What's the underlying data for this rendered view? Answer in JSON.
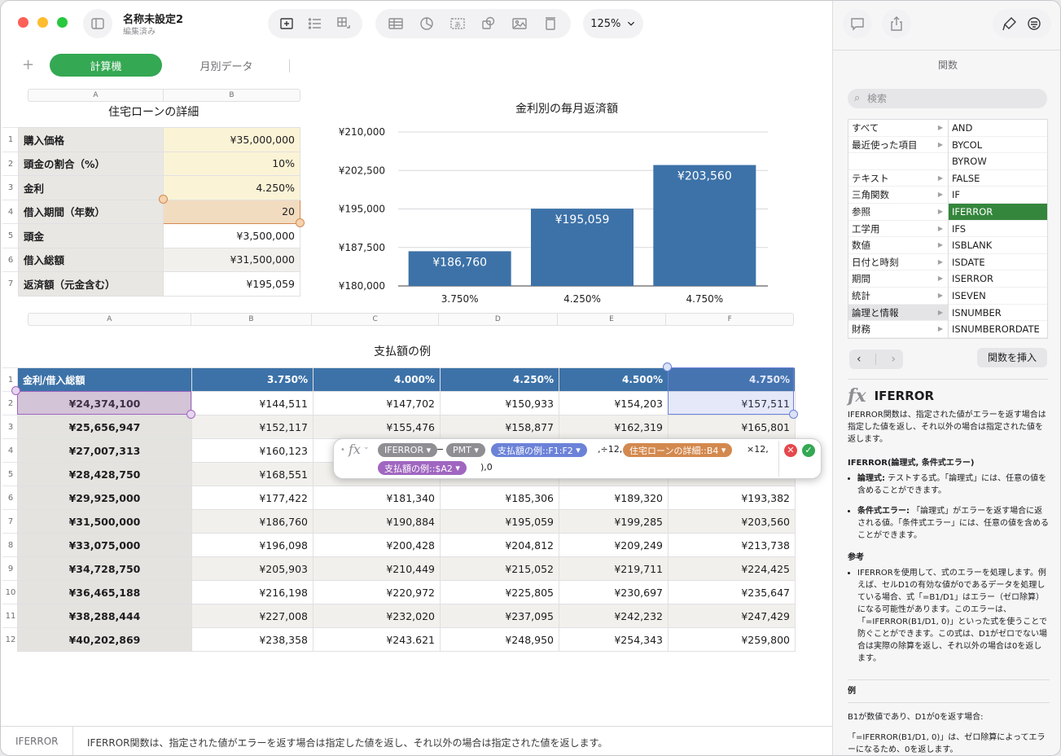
{
  "document": {
    "title": "名称未設定2",
    "subtitle": "編集済み",
    "zoom": "125%"
  },
  "tabs": [
    {
      "label": "計算機"
    },
    {
      "label": "月別データ"
    }
  ],
  "table1": {
    "title": "住宅ローンの詳細",
    "columns": [
      "A",
      "B"
    ],
    "rows": [
      {
        "num": "1",
        "label": "購入価格",
        "value": "¥35,000,000"
      },
      {
        "num": "2",
        "label": "頭金の割合（%）",
        "value": "10%"
      },
      {
        "num": "3",
        "label": "金利",
        "value": "4.250%"
      },
      {
        "num": "4",
        "label": "借入期間（年数）",
        "value": "20"
      },
      {
        "num": "5",
        "label": "頭金",
        "value": "¥3,500,000"
      },
      {
        "num": "6",
        "label": "借入総額",
        "value": "¥31,500,000"
      },
      {
        "num": "7",
        "label": "返済額（元金含む）",
        "value": "¥195,059"
      }
    ]
  },
  "chart_data": {
    "type": "bar",
    "title": "金利別の毎月返済額",
    "categories": [
      "3.750%",
      "4.250%",
      "4.750%"
    ],
    "values": [
      186760,
      195059,
      203560
    ],
    "value_labels": [
      "¥186,760",
      "¥195,059",
      "¥203,560"
    ],
    "ylim": [
      180000,
      210000
    ],
    "yticks": [
      "¥210,000",
      "¥202,500",
      "¥195,000",
      "¥187,500",
      "¥180,000"
    ],
    "color": "#3d72a8"
  },
  "table2": {
    "title": "支払額の例",
    "columns": [
      "A",
      "B",
      "C",
      "D",
      "E",
      "F"
    ],
    "header": [
      "金利/借入総額",
      "3.750%",
      "4.000%",
      "4.250%",
      "4.500%",
      "4.750%"
    ],
    "rows": [
      [
        "¥24,374,100",
        "¥144,511",
        "¥147,702",
        "¥150,933",
        "¥154,203",
        "¥157,511"
      ],
      [
        "¥25,656,947",
        "¥152,117",
        "¥155,476",
        "¥158,877",
        "¥162,319",
        "¥165,801"
      ],
      [
        "¥27,007,313",
        "¥160,123",
        "",
        "",
        "",
        ""
      ],
      [
        "¥28,428,750",
        "¥168,551",
        "",
        "",
        "",
        ""
      ],
      [
        "¥29,925,000",
        "¥177,422",
        "¥181,340",
        "¥185,306",
        "¥189,320",
        "¥193,382"
      ],
      [
        "¥31,500,000",
        "¥186,760",
        "¥190,884",
        "¥195,059",
        "¥199,285",
        "¥203,560"
      ],
      [
        "¥33,075,000",
        "¥196,098",
        "¥200,428",
        "¥204,812",
        "¥209,249",
        "¥213,738"
      ],
      [
        "¥34,728,750",
        "¥205,903",
        "¥210,449",
        "¥215,052",
        "¥219,711",
        "¥224,425"
      ],
      [
        "¥36,465,188",
        "¥216,198",
        "¥220,972",
        "¥225,805",
        "¥230,697",
        "¥235,647"
      ],
      [
        "¥38,288,444",
        "¥227,008",
        "¥232,020",
        "¥237,095",
        "¥242,232",
        "¥247,429"
      ],
      [
        "¥40,202,869",
        "¥238,358",
        "¥243.621",
        "¥248,950",
        "¥254,343",
        "¥259,800"
      ]
    ]
  },
  "formula": {
    "fn": "IFERROR",
    "minus": "−",
    "pmt": "PMT",
    "ref1": "支払額の例::F1:F2",
    "mid1": ",÷12,",
    "ref2": "住宅ローンの詳細::B4",
    "mid2": "×12,",
    "ref3": "支払額の例::$A2",
    "end": "),0"
  },
  "sidebar": {
    "title": "関数",
    "search_placeholder": "検索",
    "categories": [
      "すべて",
      "最近使った項目",
      "",
      "テキスト",
      "三角関数",
      "参照",
      "工学用",
      "数値",
      "日付と時刻",
      "期間",
      "統計",
      "論理と情報",
      "財務"
    ],
    "functions": [
      "AND",
      "BYCOL",
      "BYROW",
      "FALSE",
      "IF",
      "IFERROR",
      "IFS",
      "ISBLANK",
      "ISDATE",
      "ISERROR",
      "ISEVEN",
      "ISNUMBER",
      "ISNUMBERORDATE"
    ],
    "insert_button": "関数を挿入",
    "help": {
      "name": "IFERROR",
      "desc": "IFERROR関数は、指定された値がエラーを返す場合は指定した値を返し、それ以外の場合は指定された値を返します。",
      "syntax": "IFERROR(論理式, 条件式エラー)",
      "arg1_name": "論理式:",
      "arg1_text": " テストする式。「論理式」には、任意の値を含めることができます。",
      "arg2_name": "条件式エラー:",
      "arg2_text": " 「論理式」がエラーを返す場合に返される値。「条件式エラー」には、任意の値を含めることができます。",
      "notes_title": "参考",
      "notes": "IFERRORを使用して、式のエラーを処理します。例えば、セルD1の有効な値が0であるデータを処理している場合、式「=B1/D1」はエラー（ゼロ除算）になる可能性があります。このエラーは、「=IFERROR(B1/D1, 0)」といった式を使うことで防ぐことができます。この式は、D1がゼロでない場合は実際の除算を返し、それ以外の場合は0を返します。",
      "example_title": "例",
      "example1": "B1が数値であり、D1が0を返す場合:",
      "example2": "「=IFERROR(B1/D1, 0)」は、ゼロ除算によってエラーになるため、0を返します。"
    }
  },
  "status": {
    "fn": "IFERROR",
    "text": "IFERROR関数は、指定された値がエラーを返す場合は指定した値を返し、それ以外の場合は指定された値を返します。"
  }
}
